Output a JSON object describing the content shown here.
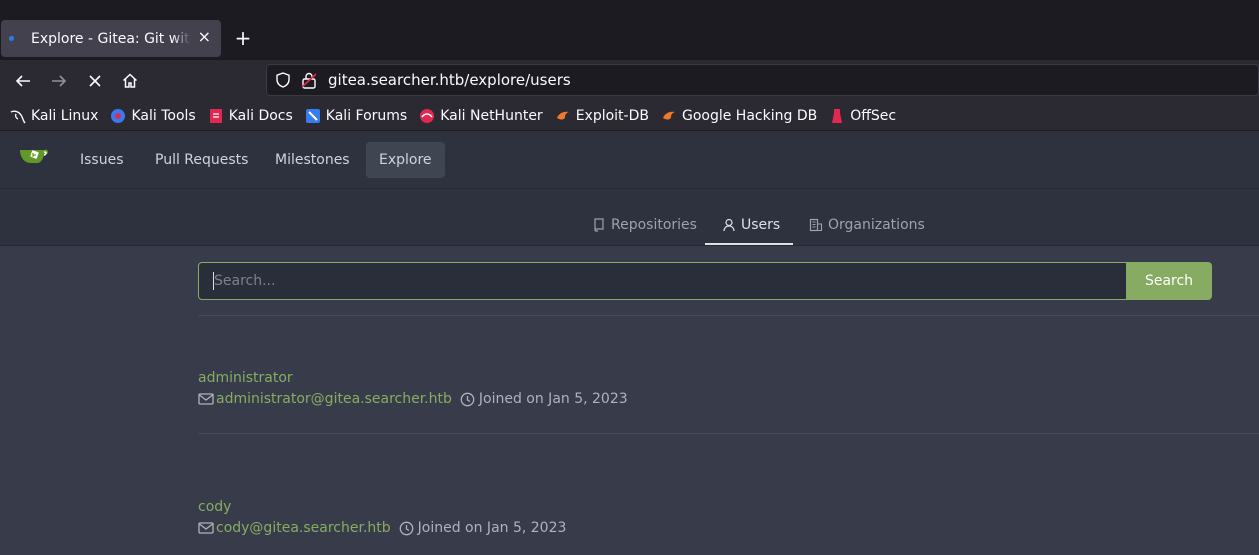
{
  "browser": {
    "tab_title": "Explore - Gitea: Git with a cup of tea",
    "tab_close": "×",
    "new_tab": "+",
    "url": "gitea.searcher.htb/explore/users"
  },
  "bookmarks": [
    {
      "label": "Kali Linux",
      "icon": "kali-dragon-icon"
    },
    {
      "label": "Kali Tools",
      "icon": "kali-tools-icon"
    },
    {
      "label": "Kali Docs",
      "icon": "kali-docs-icon"
    },
    {
      "label": "Kali Forums",
      "icon": "kali-forums-icon"
    },
    {
      "label": "Kali NetHunter",
      "icon": "kali-nethunter-icon"
    },
    {
      "label": "Exploit-DB",
      "icon": "exploit-db-icon"
    },
    {
      "label": "Google Hacking DB",
      "icon": "ghdb-icon"
    },
    {
      "label": "OffSec",
      "icon": "offsec-icon"
    }
  ],
  "gitea": {
    "nav": [
      {
        "label": "Issues",
        "active": false
      },
      {
        "label": "Pull Requests",
        "active": false
      },
      {
        "label": "Milestones",
        "active": false
      },
      {
        "label": "Explore",
        "active": true
      }
    ],
    "subtabs": [
      {
        "label": "Repositories",
        "icon": "repo-icon",
        "active": false
      },
      {
        "label": "Users",
        "icon": "person-icon",
        "active": true
      },
      {
        "label": "Organizations",
        "icon": "organization-icon",
        "active": false
      }
    ],
    "search": {
      "placeholder": "Search...",
      "button": "Search"
    },
    "users": [
      {
        "name": "administrator",
        "email": "administrator@gitea.searcher.htb",
        "joined": "Joined on Jan 5, 2023"
      },
      {
        "name": "cody",
        "email": "cody@gitea.searcher.htb",
        "joined": "Joined on Jan 5, 2023"
      }
    ],
    "colors": {
      "accent": "#87ab63",
      "background": "#383c4a",
      "nav": "#2e323e"
    }
  }
}
